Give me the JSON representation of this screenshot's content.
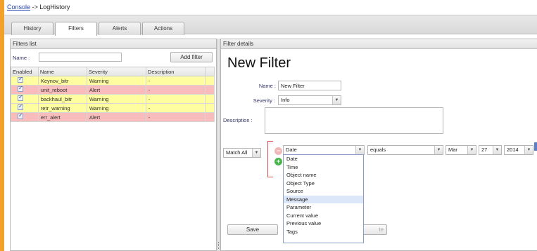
{
  "breadcrumb": {
    "link": "Console",
    "separator": " -> ",
    "current": "LogHistory"
  },
  "tabs": [
    {
      "label": "History",
      "active": false
    },
    {
      "label": "Filters",
      "active": true
    },
    {
      "label": "Alerts",
      "active": false
    },
    {
      "label": "Actions",
      "active": false
    }
  ],
  "filters_list": {
    "header": "Filters list",
    "name_label": "Name :",
    "name_value": "",
    "add_button": "Add filter",
    "columns": [
      "Enabled",
      "Name",
      "Severity",
      "Description"
    ],
    "rows": [
      {
        "enabled": true,
        "name": "Keynov_bitr",
        "severity": "Warning",
        "description": "-"
      },
      {
        "enabled": true,
        "name": "unit_reboot",
        "severity": "Alert",
        "description": "-"
      },
      {
        "enabled": true,
        "name": "backhaul_bitr",
        "severity": "Warning",
        "description": "-"
      },
      {
        "enabled": true,
        "name": "retr_warning",
        "severity": "Warning",
        "description": "-"
      },
      {
        "enabled": true,
        "name": "err_alert",
        "severity": "Alert",
        "description": "-"
      }
    ]
  },
  "filter_details": {
    "header": "Filter details",
    "title": "New Filter",
    "name_label": "Name :",
    "name_value": "New Filter",
    "severity_label": "Severity :",
    "severity_value": "Info",
    "description_label": "Description :",
    "description_value": "",
    "match_value": "Match All",
    "condition": {
      "field_value": "Date",
      "operator_value": "equals",
      "month_value": "Mar",
      "day_value": "27",
      "year_value": "2014"
    },
    "field_options": [
      "Date",
      "Time",
      "Object name",
      "Object Type",
      "Source",
      "Message",
      "Parameter",
      "Current value",
      "Previous value",
      "Tags"
    ],
    "highlighted_option": "Message",
    "save_button": "Save",
    "partial_button_text": "te"
  },
  "colors": {
    "warning_row": "#fefea0",
    "alert_row": "#f9bcbc",
    "frame": "#f3a12a"
  }
}
